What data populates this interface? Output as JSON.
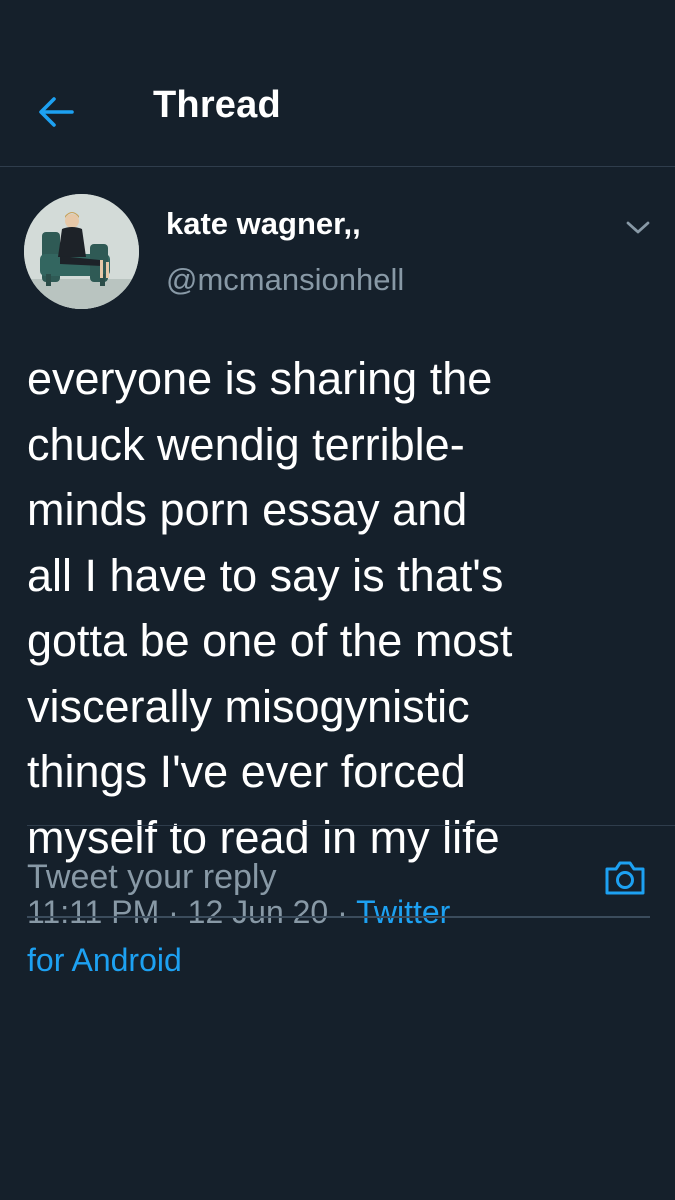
{
  "header": {
    "title": "Thread",
    "back_icon": "arrow-left-icon"
  },
  "tweet": {
    "display_name": "kate wagner,,",
    "handle": "@mcmansionhell",
    "text": "everyone is sharing the\nchuck wendig terrible-\nminds porn essay and\nall I have to say is that's\ngotta be one of the most\nviscerally misogynistic\nthings I've ever forced\nmyself to read in my life",
    "time": "11:11 PM",
    "date": "12 Jun 20",
    "separator": " · ",
    "source": "Twitter\nfor Android",
    "caret_icon": "chevron-down-icon"
  },
  "reply": {
    "placeholder": "Tweet your reply",
    "camera_icon": "camera-icon"
  },
  "colors": {
    "background": "#15202b",
    "accent": "#1da1f2",
    "secondary_text": "#8899a6",
    "divider": "#2f3d4c"
  }
}
